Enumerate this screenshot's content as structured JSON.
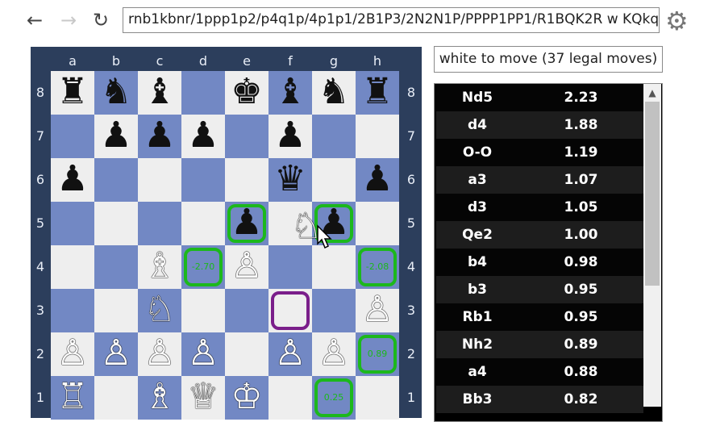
{
  "toolbar": {
    "back_icon": "arrow-left-icon",
    "forward_icon": "arrow-right-icon",
    "reload_icon": "reload-icon",
    "fen": "rnb1kbnr/1ppp1p2/p4q1p/4p1p1/2B1P3/2N2N1P/PPPP1PP1/R1BQK2R w KQkq",
    "settings_icon": "gear-icon"
  },
  "status": "white to move (37 legal moves)",
  "board": {
    "files": [
      "a",
      "b",
      "c",
      "d",
      "e",
      "f",
      "g",
      "h"
    ],
    "ranks": [
      "8",
      "7",
      "6",
      "5",
      "4",
      "3",
      "2",
      "1"
    ],
    "pieces": [
      {
        "sq": "a8",
        "glyph": "♜",
        "color": "black"
      },
      {
        "sq": "b8",
        "glyph": "♞",
        "color": "black"
      },
      {
        "sq": "c8",
        "glyph": "♝",
        "color": "black"
      },
      {
        "sq": "e8",
        "glyph": "♚",
        "color": "black"
      },
      {
        "sq": "f8",
        "glyph": "♝",
        "color": "black"
      },
      {
        "sq": "g8",
        "glyph": "♞",
        "color": "black"
      },
      {
        "sq": "h8",
        "glyph": "♜",
        "color": "black"
      },
      {
        "sq": "b7",
        "glyph": "♟",
        "color": "black"
      },
      {
        "sq": "c7",
        "glyph": "♟",
        "color": "black"
      },
      {
        "sq": "d7",
        "glyph": "♟",
        "color": "black"
      },
      {
        "sq": "f7",
        "glyph": "♟",
        "color": "black"
      },
      {
        "sq": "a6",
        "glyph": "♟",
        "color": "black"
      },
      {
        "sq": "f6",
        "glyph": "♛",
        "color": "black"
      },
      {
        "sq": "h6",
        "glyph": "♟",
        "color": "black"
      },
      {
        "sq": "e5",
        "glyph": "♟",
        "color": "black"
      },
      {
        "sq": "g5",
        "glyph": "♟",
        "color": "black"
      },
      {
        "sq": "c4",
        "glyph": "♗",
        "color": "white"
      },
      {
        "sq": "e4",
        "glyph": "♙",
        "color": "white"
      },
      {
        "sq": "c3",
        "glyph": "♘",
        "color": "white"
      },
      {
        "sq": "h3",
        "glyph": "♙",
        "color": "white"
      },
      {
        "sq": "a2",
        "glyph": "♙",
        "color": "white"
      },
      {
        "sq": "b2",
        "glyph": "♙",
        "color": "white"
      },
      {
        "sq": "c2",
        "glyph": "♙",
        "color": "white"
      },
      {
        "sq": "d2",
        "glyph": "♙",
        "color": "white"
      },
      {
        "sq": "f2",
        "glyph": "♙",
        "color": "white"
      },
      {
        "sq": "g2",
        "glyph": "♙",
        "color": "white"
      },
      {
        "sq": "a1",
        "glyph": "♖",
        "color": "white"
      },
      {
        "sq": "c1",
        "glyph": "♗",
        "color": "white"
      },
      {
        "sq": "d1",
        "glyph": "♕",
        "color": "white"
      },
      {
        "sq": "e1",
        "glyph": "♔",
        "color": "white"
      }
    ],
    "dragging": {
      "glyph": "♘",
      "color": "white",
      "near": "f5"
    },
    "highlights": [
      {
        "sq": "e5",
        "color": "green",
        "label": ""
      },
      {
        "sq": "g5",
        "color": "green",
        "label": ""
      },
      {
        "sq": "d4",
        "color": "green",
        "label": "-2.70"
      },
      {
        "sq": "h4",
        "color": "green",
        "label": "-2.08"
      },
      {
        "sq": "h2",
        "color": "green",
        "label": "0.89"
      },
      {
        "sq": "g1",
        "color": "green",
        "label": "0.25"
      },
      {
        "sq": "f3",
        "color": "purple",
        "label": ""
      }
    ]
  },
  "moves": [
    {
      "move": "Nd5",
      "score": "2.23"
    },
    {
      "move": "d4",
      "score": "1.88"
    },
    {
      "move": "O-O",
      "score": "1.19"
    },
    {
      "move": "a3",
      "score": "1.07"
    },
    {
      "move": "d3",
      "score": "1.05"
    },
    {
      "move": "Qe2",
      "score": "1.00"
    },
    {
      "move": "b4",
      "score": "0.98"
    },
    {
      "move": "b3",
      "score": "0.95"
    },
    {
      "move": "Rb1",
      "score": "0.95"
    },
    {
      "move": "Nh2",
      "score": "0.89"
    },
    {
      "move": "a4",
      "score": "0.88"
    },
    {
      "move": "Bb3",
      "score": "0.82"
    }
  ],
  "colors": {
    "light": "#eeeeee",
    "dark": "#7288c4",
    "frame": "#2c3e5c",
    "highlight": "#1cb81c",
    "selected": "#7a1e8a"
  }
}
